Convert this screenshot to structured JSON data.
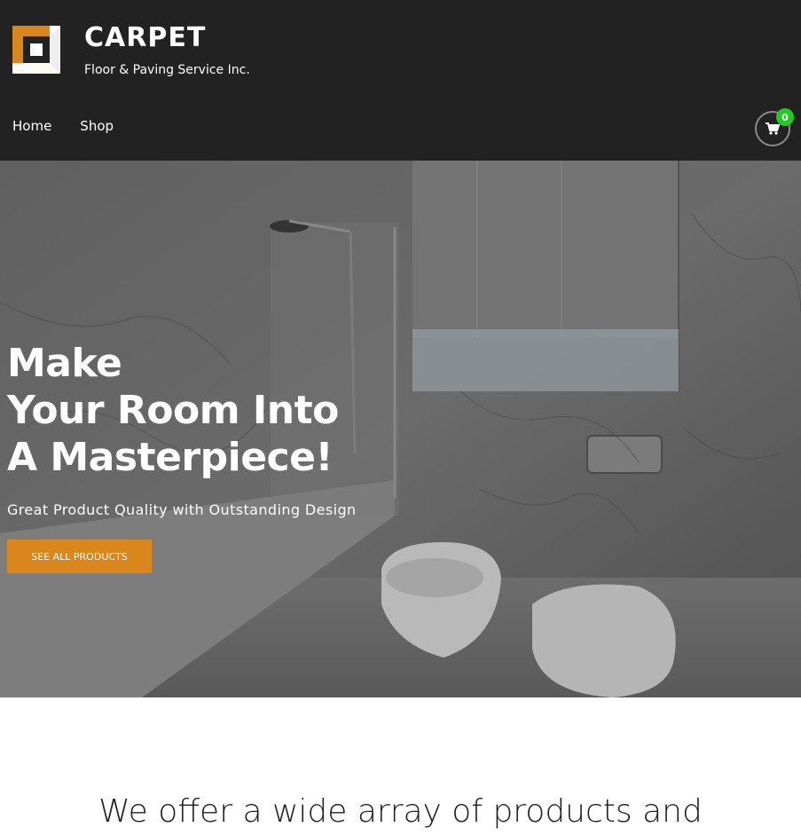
{
  "brand": {
    "name": "CARPET",
    "tagline": "Floor & Paving Service Inc.",
    "accent_color": "#d9861c"
  },
  "nav": {
    "items": [
      {
        "label": "Home"
      },
      {
        "label": "Shop"
      }
    ]
  },
  "cart": {
    "icon": "shopping-cart-icon",
    "count": "0",
    "badge_color": "#1fcc1f"
  },
  "hero": {
    "title_lines": [
      "Make",
      "Your Room Into",
      "A Masterpiece!"
    ],
    "subtitle": "Great Product Quality with Outstanding Design",
    "button_label": "SEE ALL PRODUCTS",
    "image": "bathroom-marble-photo"
  },
  "intro": {
    "heading": "We offer a wide array of products and"
  }
}
